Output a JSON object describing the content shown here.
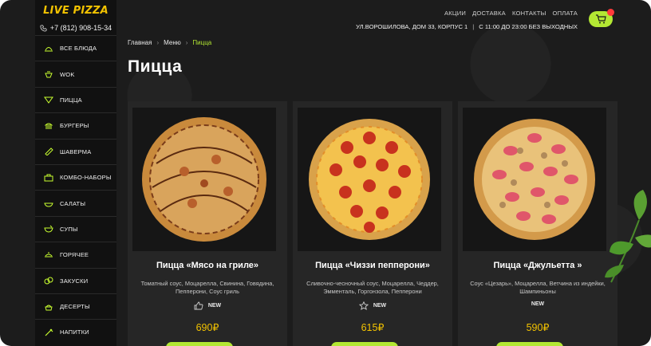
{
  "brand": {
    "logo": "LIVE PIZZA",
    "phone": "+7 (812) 908-15-34"
  },
  "menu": [
    {
      "label": "ВСЕ БЛЮДА",
      "icon": "dish-icon"
    },
    {
      "label": "WOK",
      "icon": "wok-icon"
    },
    {
      "label": "ПИЦЦА",
      "icon": "pizza-icon"
    },
    {
      "label": "БУРГЕРЫ",
      "icon": "burger-icon"
    },
    {
      "label": "ШАВЕРМА",
      "icon": "shawarma-icon"
    },
    {
      "label": "КОМБО-НАБОРЫ",
      "icon": "combo-icon"
    },
    {
      "label": "САЛАТЫ",
      "icon": "salad-icon"
    },
    {
      "label": "СУПЫ",
      "icon": "soup-icon"
    },
    {
      "label": "ГОРЯЧЕЕ",
      "icon": "hot-dish-icon"
    },
    {
      "label": "ЗАКУСКИ",
      "icon": "snacks-icon"
    },
    {
      "label": "ДЕСЕРТЫ",
      "icon": "dessert-icon"
    },
    {
      "label": "НАПИТКИ",
      "icon": "drinks-icon"
    }
  ],
  "topnav": {
    "promo": "АКЦИИ",
    "delivery": "ДОСТАВКА",
    "contacts": "КОНТАКТЫ",
    "payment": "ОПЛАТА"
  },
  "header": {
    "address": "УЛ.ВОРОШИЛОВА, ДОМ 33, КОРПУС 1",
    "separator": "|",
    "hours": "С 11:00 ДО 23:00 БЕЗ ВЫХОДНЫХ"
  },
  "breadcrumb": {
    "home": "Главная",
    "menu": "Меню",
    "current": "Пицца",
    "arrow": "›"
  },
  "page_title": "Пицца",
  "products": [
    {
      "name": "Пицца «Мясо на гриле»",
      "desc": "Томатный соус, Моцарелла, Свинина, Говядина, Пепперони, Соус гриль",
      "tag": "NEW",
      "tag_icon": "thumbs-up-icon",
      "price": "690₽"
    },
    {
      "name": "Пицца «Чиззи пепперони»",
      "desc": "Сливочно-чесночный соус, Моцарелла, Чеддер, Эмменталь, Горгонзола, Пепперони",
      "tag": "NEW",
      "tag_icon": "star-icon",
      "price": "615₽"
    },
    {
      "name": "Пицца «Джульетта »",
      "desc": "Соус «Цезарь», Моцарелла, Ветчина из индейки, Шампиньоны",
      "tag": "NEW",
      "tag_icon": "",
      "price": "590₽"
    }
  ],
  "colors": {
    "accent": "#b3e833",
    "price": "#f2c200",
    "logo": "#f2c200",
    "badge": "#ff3b3b"
  }
}
